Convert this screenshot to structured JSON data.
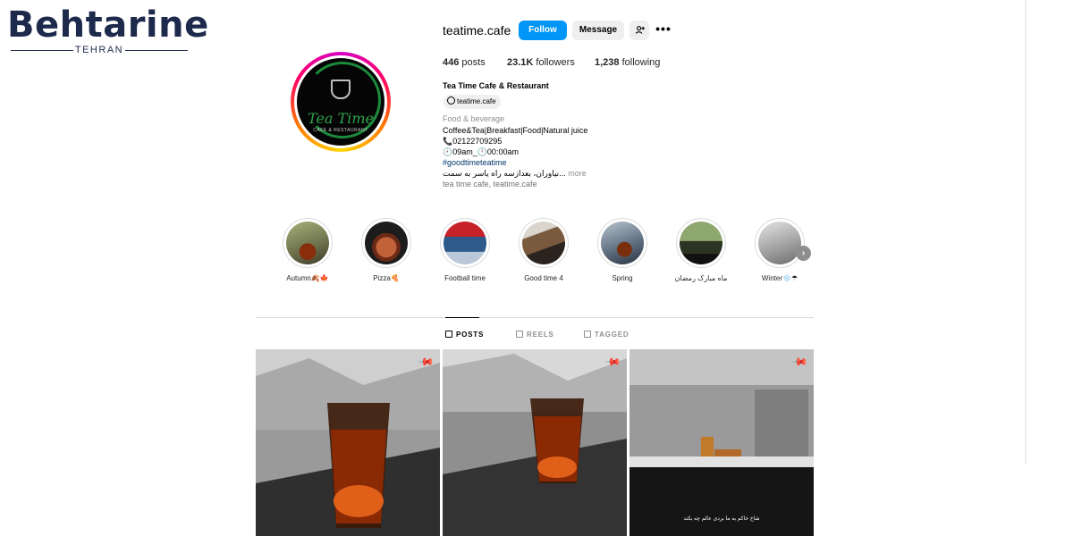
{
  "watermark": {
    "logo_text": "Behtarine",
    "logo_sub": "TEHRAN"
  },
  "profile": {
    "username": "teatime.cafe",
    "follow_label": "Follow",
    "message_label": "Message",
    "more_label": "•••",
    "avatar_brand": "Tea Time",
    "avatar_brand_sub": "CAFE & RESTAURANT",
    "stats": {
      "posts_count": "446",
      "posts_label": "posts",
      "followers_count": "23.1K",
      "followers_label": "followers",
      "following_count": "1,238",
      "following_label": "following"
    },
    "full_name": "Tea Time Cafe & Restaurant",
    "threads_handle": "teatime.cafe",
    "category": "Food & beverage",
    "bio_lines": {
      "line1": "Coffee&Tea|Breakfast|Food|Natural juice",
      "phone": "📞02122709295",
      "hours": "🕘09am_🕛00:00am",
      "hashtag": "#goodtimeteatime",
      "address": "نیاوران، بعدازسه راه یاسر به سمت...",
      "more": " more",
      "links": "tea time cafe, teatime.cafe"
    }
  },
  "highlights": [
    {
      "label": "Autumn🍂🍁"
    },
    {
      "label": "Pizza🍕"
    },
    {
      "label": "Football time"
    },
    {
      "label": "Good time 4"
    },
    {
      "label": "Spring"
    },
    {
      "label": "ماه مبارک رمضان"
    },
    {
      "label": "Winter❄️☂"
    }
  ],
  "tabs": [
    {
      "label": "POSTS",
      "active": true
    },
    {
      "label": "REELS",
      "active": false
    },
    {
      "label": "TAGGED",
      "active": false
    }
  ],
  "posts": [
    {
      "pinned": true,
      "caption": ""
    },
    {
      "pinned": true,
      "caption": ""
    },
    {
      "pinned": true,
      "caption": "شاخ خاکم به ما بردی عالم چه بکند"
    }
  ],
  "colors": {
    "follow_button": "#0095f6",
    "secondary_button": "#efefef",
    "hashtag": "#00376b",
    "muted_text": "#8e8e8e"
  }
}
